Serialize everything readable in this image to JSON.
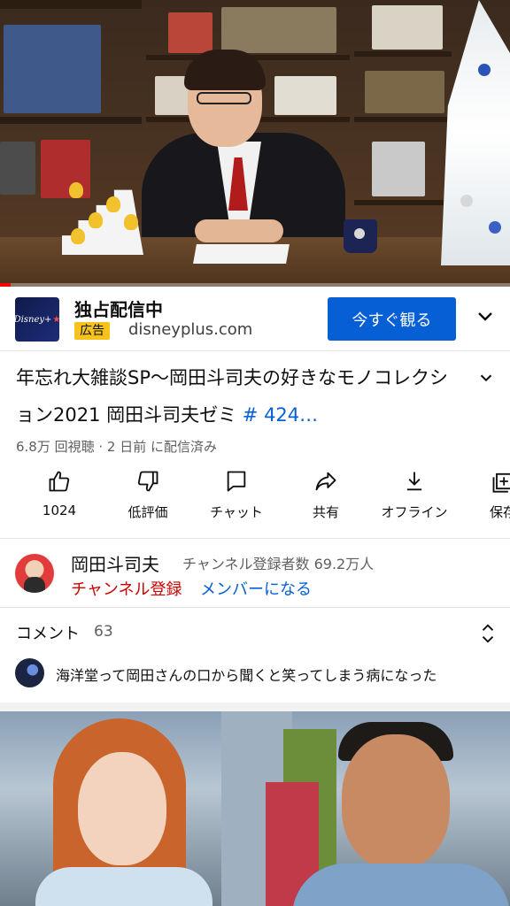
{
  "ad": {
    "title": "独占配信中",
    "badge": "広告",
    "domain": "disneyplus.com",
    "cta": "今すぐ観る",
    "logo_text": "Disney+"
  },
  "video": {
    "title_text": "年忘れ大雑談SP〜岡田斗司夫の好きなモノコレクション2021 岡田斗司夫ゼミ ",
    "title_hashtag": "# 424…",
    "meta": "6.8万 回視聴 · 2 日前 に配信済み",
    "progress_fraction": 0.02
  },
  "actions": [
    {
      "label": "1024",
      "icon": "thumbs-up-icon"
    },
    {
      "label": "低評価",
      "icon": "thumbs-down-icon"
    },
    {
      "label": "チャット",
      "icon": "chat-icon"
    },
    {
      "label": "共有",
      "icon": "share-icon"
    },
    {
      "label": "オフライン",
      "icon": "download-icon"
    },
    {
      "label": "保存",
      "icon": "save-playlist-icon"
    }
  ],
  "channel": {
    "name": "岡田斗司夫",
    "subscribers": "チャンネル登録者数 69.2万人",
    "subscribe_label": "チャンネル登録",
    "member_label": "メンバーになる"
  },
  "comments": {
    "label": "コメント",
    "count": "63",
    "top_comment": "海洋堂って岡田さんの口から聞くと笑ってしまう病になった"
  },
  "colors": {
    "accent_blue": "#065fd4",
    "subscribe_red": "#cc0000",
    "progress_red": "#ff0000",
    "ad_badge_yellow": "#f6c21c"
  }
}
